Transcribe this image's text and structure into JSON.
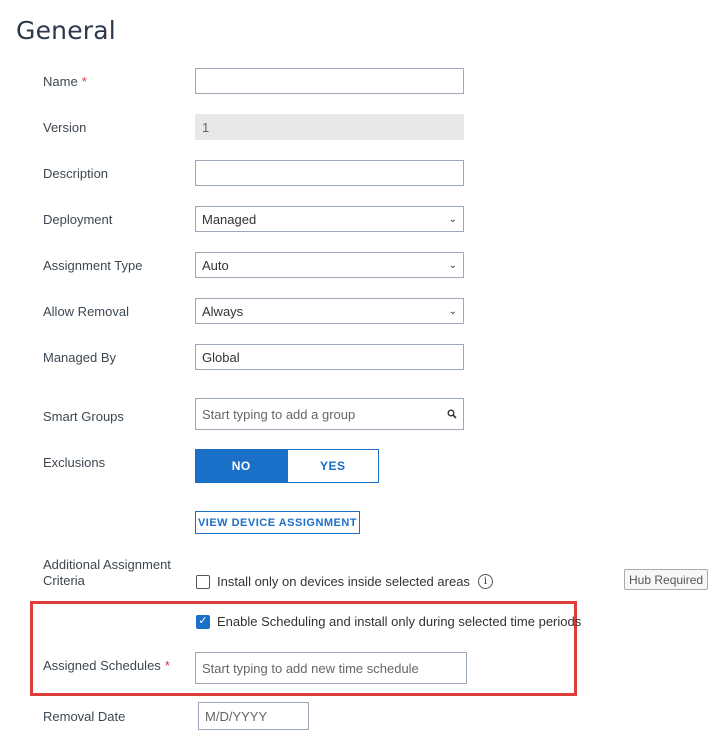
{
  "section_title": "General",
  "fields": {
    "name": {
      "label": "Name",
      "required_mark": "*",
      "value": ""
    },
    "version": {
      "label": "Version",
      "value": "1"
    },
    "description": {
      "label": "Description",
      "value": ""
    },
    "deployment": {
      "label": "Deployment",
      "value": "Managed"
    },
    "assignment_type": {
      "label": "Assignment Type",
      "value": "Auto"
    },
    "allow_removal": {
      "label": "Allow Removal",
      "value": "Always"
    },
    "managed_by": {
      "label": "Managed By",
      "value": "Global"
    },
    "smart_groups": {
      "label": "Smart Groups",
      "placeholder": "Start typing to add a group"
    },
    "exclusions": {
      "label": "Exclusions",
      "no_label": "NO",
      "yes_label": "YES",
      "selected": "NO"
    },
    "view_device_assignment": {
      "label": "VIEW DEVICE ASSIGNMENT"
    },
    "additional_criteria": {
      "label_line1": "Additional Assignment",
      "label_line2": "Criteria",
      "install_areas_label": "Install only on devices inside selected areas",
      "install_areas_checked": false,
      "info_glyph": "i",
      "hub_badge": "Hub Required"
    },
    "scheduling": {
      "label": "Enable Scheduling and install only during selected time periods",
      "checked": true,
      "check_glyph": "✓"
    },
    "assigned_schedules": {
      "label": "Assigned Schedules",
      "required_mark": "*",
      "placeholder": "Start typing to add new time schedule"
    },
    "removal_date": {
      "label": "Removal Date",
      "placeholder": "M/D/YYYY"
    }
  },
  "icons": {
    "dropdown": "chevron-down-icon",
    "search": "search-icon",
    "info": "info-icon"
  },
  "colors": {
    "accent": "#1a6fc9",
    "highlight": "#e03c3c",
    "required": "#d9363e"
  }
}
